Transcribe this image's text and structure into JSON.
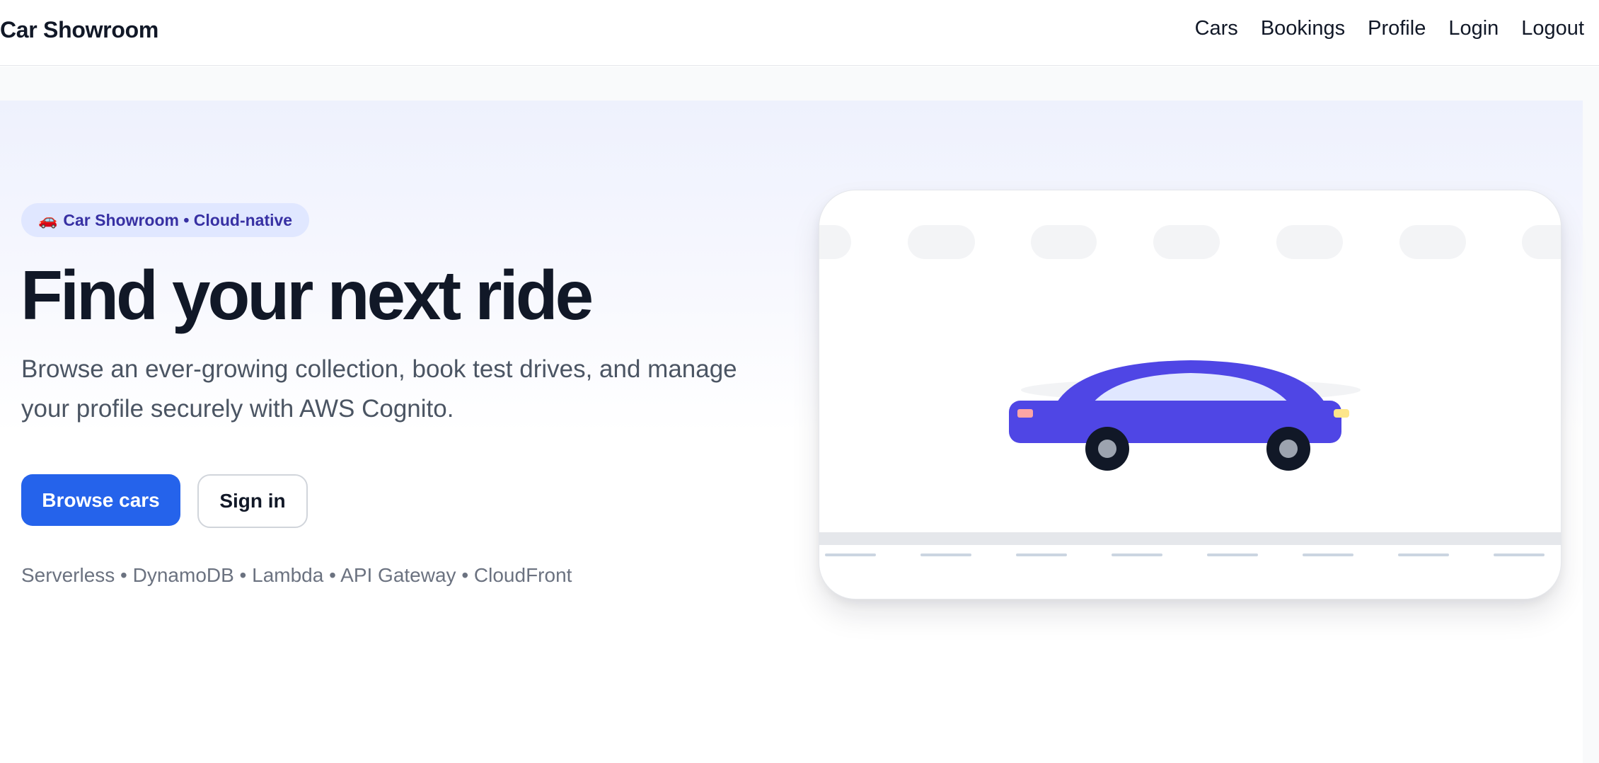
{
  "brand": "Car Showroom",
  "nav": {
    "cars": "Cars",
    "bookings": "Bookings",
    "profile": "Profile",
    "login": "Login",
    "logout": "Logout"
  },
  "hero": {
    "badge_icon": "car-emoji-icon",
    "badge_emoji": "🚗",
    "badge_text": "Car Showroom • Cloud-native",
    "title": "Find your next ride",
    "subtitle": "Browse an ever-growing collection, book test drives, and manage your profile securely with AWS Cognito.",
    "primary_cta": "Browse cars",
    "secondary_cta": "Sign in",
    "tech_stack": "Serverless • DynamoDB • Lambda • API Gateway • CloudFront"
  },
  "illustration": {
    "car_color": "#4f46e5",
    "window_color": "#e0e7ff",
    "wheel_color": "#111827",
    "hub_color": "#9ca3af",
    "road_color": "#e5e7eb",
    "road_marking_color": "#cbd5e1",
    "taillight_color": "#fca5a5",
    "headlight_color": "#fde68a"
  },
  "colors": {
    "accent": "#2563eb",
    "badge_bg": "#e0e7ff",
    "badge_text": "#3730a3"
  }
}
